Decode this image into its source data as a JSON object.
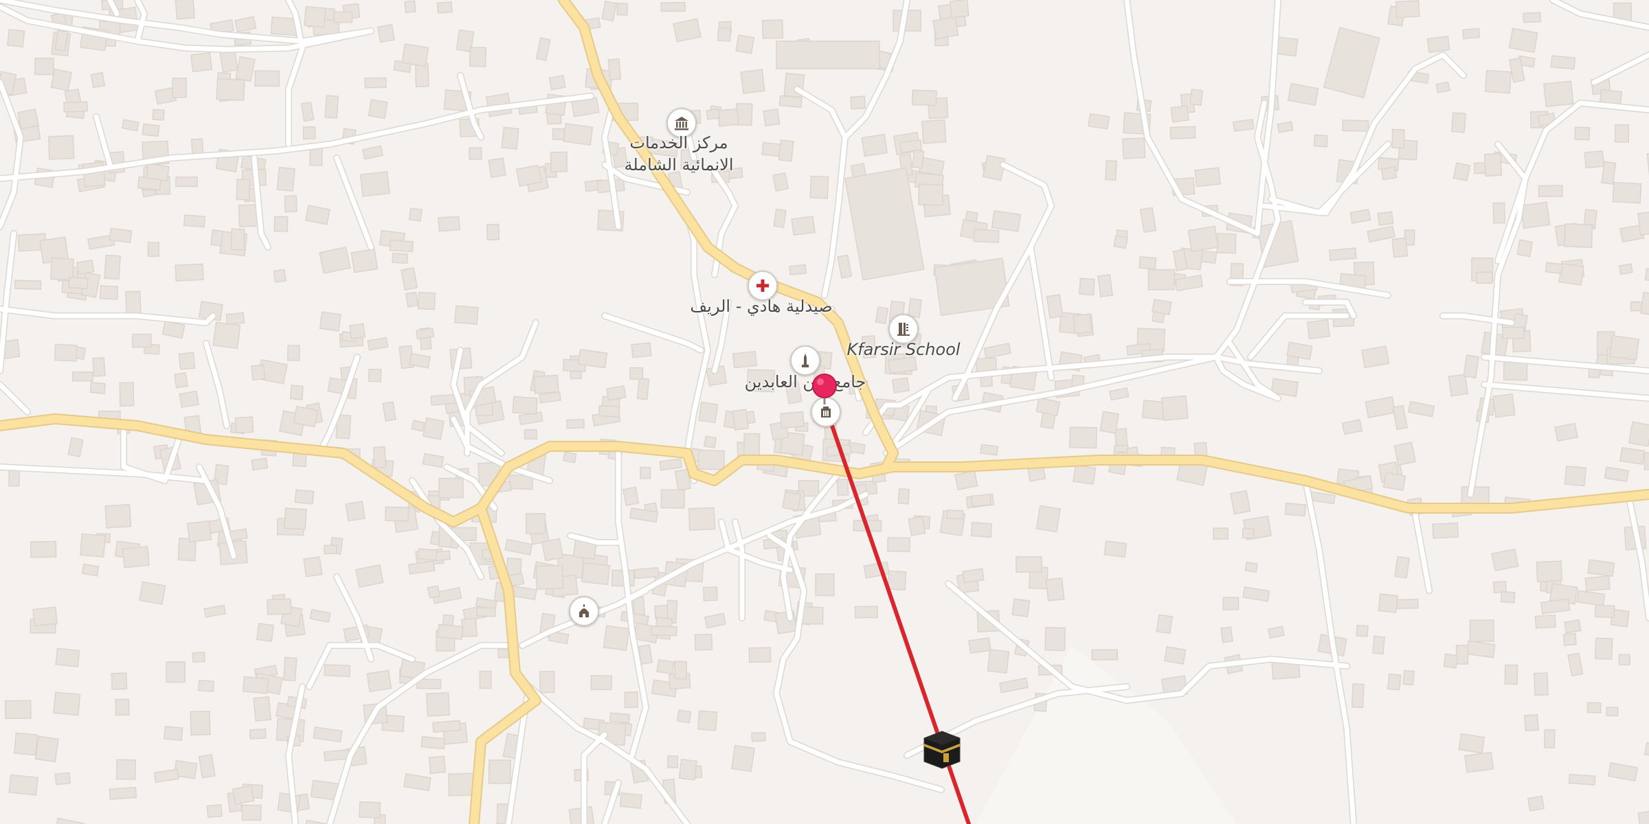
{
  "map": {
    "colors": {
      "background": "#f4f1ee",
      "building": "#e8e2dc",
      "minor_road": "#ffffff",
      "main_road": "#fbe2a1",
      "qibla_line": "#d9262e",
      "pin": "#e8265e"
    },
    "pois": [
      {
        "id": "gov",
        "icon": "government-building-icon",
        "label": "مركز الخدمات\nالانمائية الشاملة"
      },
      {
        "id": "pharmacy",
        "icon": "pharmacy-cross-icon",
        "label": "صيدلية هادي - الريف"
      },
      {
        "id": "school",
        "icon": "school-icon",
        "label": "Kfarsir School"
      },
      {
        "id": "mosque",
        "icon": "mosque-minaret-icon",
        "label": "جامع زين العابدين"
      },
      {
        "id": "mosque2",
        "icon": "mosque-dome-icon",
        "label": ""
      }
    ],
    "location_pin": {
      "icon": "location-pin-icon"
    },
    "qibla": {
      "destination_icon": "kaaba-icon",
      "line": "qibla-direction-line"
    }
  }
}
